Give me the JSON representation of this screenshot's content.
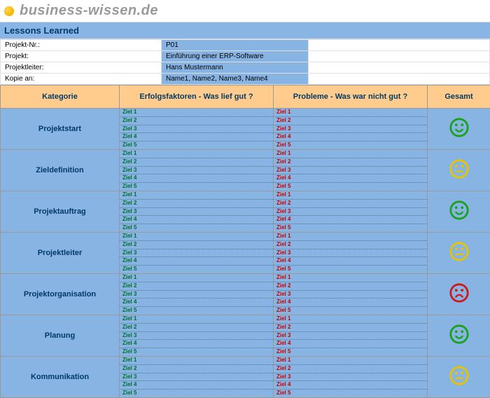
{
  "brand": "business-wissen.de",
  "title": "Lessons Learned",
  "meta": {
    "rows": [
      {
        "label": "Projekt-Nr.:",
        "value": "P01"
      },
      {
        "label": "Projekt:",
        "value": "Einführung einer ERP-Software"
      },
      {
        "label": "Projektleiter:",
        "value": "Hans Mustermann"
      },
      {
        "label": "Kopie an:",
        "value": "Name1, Name2, Name3, Name4"
      }
    ]
  },
  "columns": {
    "kategorie": "Kategorie",
    "erfolg": "Erfolgsfaktoren - Was lief gut ?",
    "probleme": "Probleme - Was war nicht gut ?",
    "gesamt": "Gesamt"
  },
  "ziele": [
    "Ziel 1",
    "Ziel 2",
    "Ziel 3",
    "Ziel 4",
    "Ziel 5"
  ],
  "rows": [
    {
      "kategorie": "Projektstart",
      "mood": "happy-green"
    },
    {
      "kategorie": "Zieldefinition",
      "mood": "neutral-yellow"
    },
    {
      "kategorie": "Projektauftrag",
      "mood": "happy-green"
    },
    {
      "kategorie": "Projektleiter",
      "mood": "neutral-yellow"
    },
    {
      "kategorie": "Projektorganisation",
      "mood": "sad-red"
    },
    {
      "kategorie": "Planung",
      "mood": "happy-green"
    },
    {
      "kategorie": "Kommunikation",
      "mood": "neutral-yellow"
    }
  ],
  "colors": {
    "happy-green": "#1aa21a",
    "neutral-yellow": "#e6c400",
    "sad-red": "#d01818"
  }
}
